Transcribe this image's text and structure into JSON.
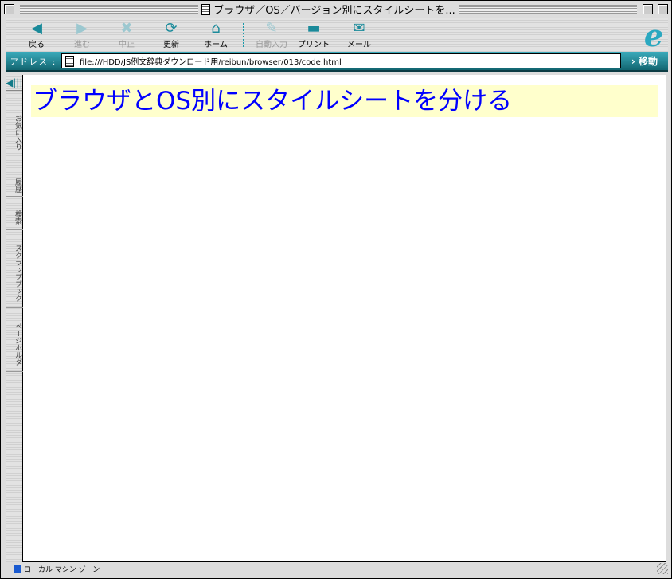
{
  "window": {
    "title": "ブラウザ／OS／バージョン別にスタイルシートを..."
  },
  "toolbar": {
    "items": [
      {
        "label": "戻る",
        "icon": "back-arrow-icon",
        "enabled": true
      },
      {
        "label": "進む",
        "icon": "forward-arrow-icon",
        "enabled": false
      },
      {
        "label": "中止",
        "icon": "stop-icon",
        "enabled": false
      },
      {
        "label": "更新",
        "icon": "refresh-icon",
        "enabled": true
      },
      {
        "label": "ホーム",
        "icon": "home-icon",
        "enabled": true
      },
      {
        "label": "自動入力",
        "icon": "autofill-icon",
        "enabled": false
      },
      {
        "label": "プリント",
        "icon": "print-icon",
        "enabled": true
      },
      {
        "label": "メール",
        "icon": "mail-icon",
        "enabled": true
      }
    ]
  },
  "address": {
    "label": "アドレス :",
    "url": "file:///HDD/JS例文辞典ダウンロード用/reibun/browser/013/code.html",
    "go_label": "移動"
  },
  "sidebar": {
    "tabs": [
      "お気に入り",
      "履歴",
      "検索",
      "スクラップブック",
      "ページホルダ"
    ]
  },
  "page": {
    "heading": "ブラウザとOS別にスタイルシートを分ける"
  },
  "status": {
    "zone": "ローカル マシン ゾーン"
  },
  "colors": {
    "accent": "#1a8a9a",
    "heading_text": "#0000ff",
    "heading_bg": "#ffffcc"
  }
}
